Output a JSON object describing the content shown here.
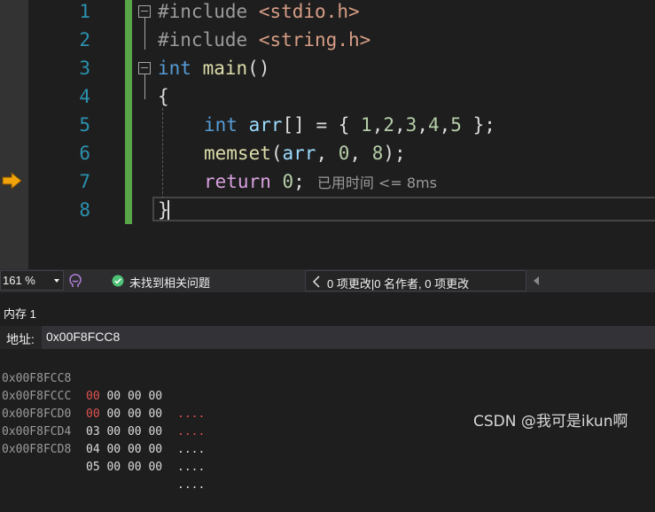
{
  "editor": {
    "line_numbers": [
      "1",
      "2",
      "3",
      "4",
      "5",
      "6",
      "7",
      "8"
    ],
    "lines": {
      "l1": {
        "directive": "#include",
        "header": "<stdio.h>"
      },
      "l2": {
        "directive": "#include",
        "header": "<string.h>"
      },
      "l3": {
        "type": "int",
        "name": "main",
        "parens": "()"
      },
      "l4": {
        "brace": "{"
      },
      "l5": {
        "type": "int",
        "var": "arr",
        "rest_a": "[] = { ",
        "n1": "1",
        "c1": ",",
        "n2": "2",
        "c2": ",",
        "n3": "3",
        "c3": ",",
        "n4": "4",
        "c4": ",",
        "n5": "5",
        "end": " };"
      },
      "l6": {
        "fn": "memset",
        "open": "(",
        "var": "arr",
        "sep1": ", ",
        "n1": "0",
        "sep2": ", ",
        "n2": "8",
        "end": ");"
      },
      "l7": {
        "keyword": "return",
        "space": " ",
        "value": "0",
        "semi": ";",
        "perf_tip": "已用时间 <= 8ms"
      },
      "l8": {
        "brace": "}"
      }
    },
    "current_line": "8",
    "breakpoint_arrow_line": "7"
  },
  "status_bar": {
    "zoom": "161 %",
    "issues_text": "未找到相关问题",
    "codelens_text": "0 项更改|0 名作者, 0 项更改"
  },
  "memory_window": {
    "title": "内存 1",
    "address_label": "地址:",
    "address_value": "0x00F8FCC8",
    "rows": [
      {
        "address": "0x00F8FCC8",
        "changed": "00",
        "bytes": " 00 00 00",
        "ascii": "....",
        "highlight": true
      },
      {
        "address": "0x00F8FCCC",
        "changed": "00",
        "bytes": " 00 00 00",
        "ascii": "....",
        "highlight": true
      },
      {
        "address": "0x00F8FCD0",
        "changed": "",
        "bytes": "03 00 00 00",
        "ascii": "....",
        "highlight": false
      },
      {
        "address": "0x00F8FCD4",
        "changed": "",
        "bytes": "04 00 00 00",
        "ascii": "....",
        "highlight": false
      },
      {
        "address": "0x00F8FCD8",
        "changed": "",
        "bytes": "05 00 00 00",
        "ascii": "....",
        "highlight": false
      }
    ]
  },
  "watermark": "CSDN @我可是ikun啊",
  "colors": {
    "background": "#1e1e1e",
    "change_bar": "#57a64a",
    "line_number": "#2b91af",
    "keyword": "#569cd6",
    "control_keyword": "#d8a0df",
    "number": "#b5cea8",
    "changed_memory": "#e05252",
    "breakpoint_arrow": "#f0a30a"
  }
}
